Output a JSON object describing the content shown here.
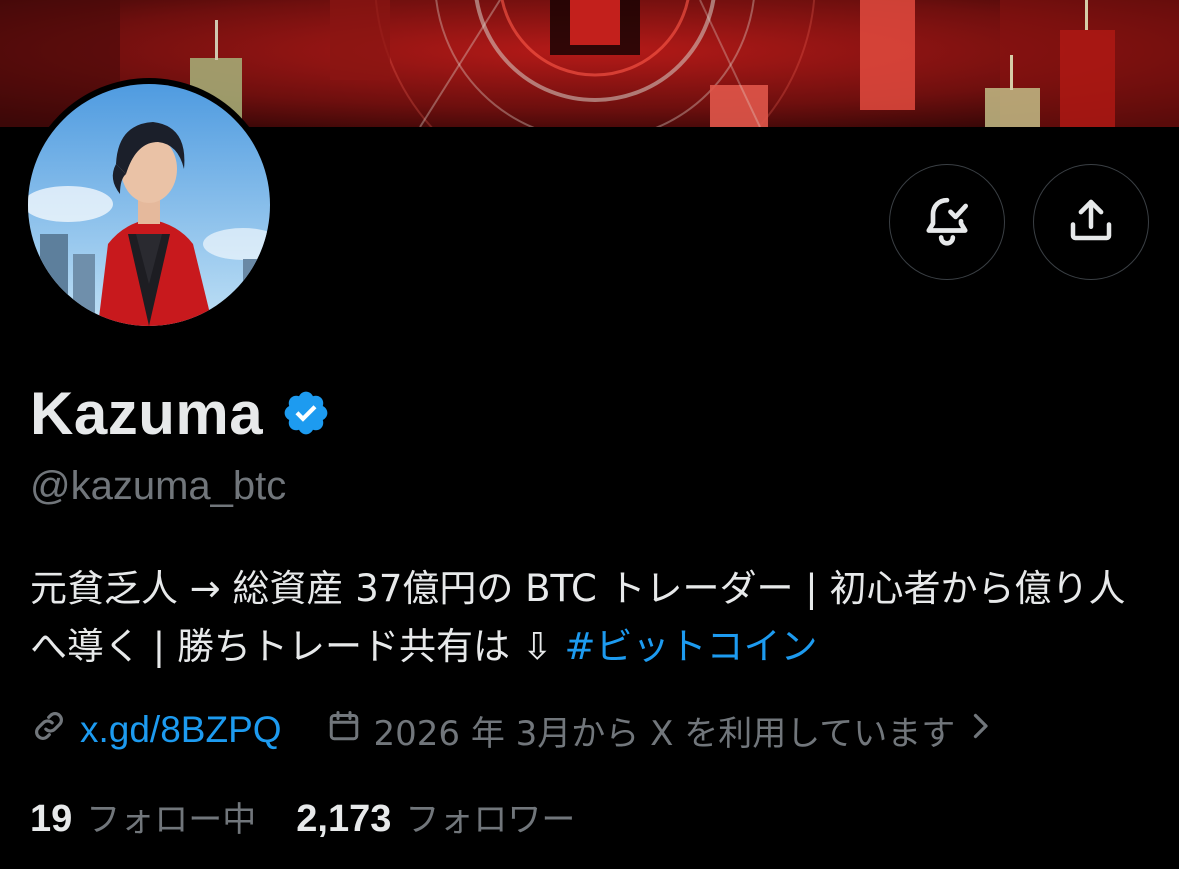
{
  "profile": {
    "display_name": "Kazuma",
    "handle": "@kazuma_btc",
    "verified": true,
    "verified_color": "#1d9bf0",
    "bio_text": "元貧乏人 → 総資産 37億円の BTC トレーダー | 初心者から億り人へ導く | 勝ちトレード共有は ⇩ ",
    "bio_hashtag": "#ビットコイン",
    "link_text": "x.gd/8BZPQ",
    "joined_text": "2026 年 3月から X を利用しています",
    "following_count": "19",
    "following_label": "フォロー中",
    "followers_count": "2,173",
    "followers_label": "フォロワー"
  },
  "icons": {
    "notify": "bell-check-icon",
    "share": "share-upload-icon",
    "link": "link-icon",
    "calendar": "calendar-icon",
    "chevron": "chevron-right-icon",
    "verified": "verified-badge-icon"
  },
  "colors": {
    "background": "#000000",
    "text_primary": "#e7e9ea",
    "text_secondary": "#71767b",
    "accent": "#1d9bf0",
    "banner_red": "#c0221f"
  }
}
